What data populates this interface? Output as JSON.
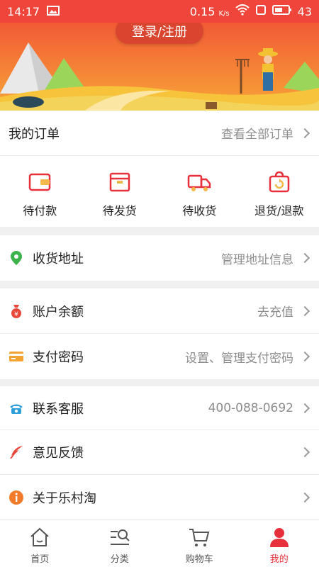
{
  "status_bar": {
    "time": "14:17",
    "net_speed": "0.15",
    "net_unit": "K/s",
    "battery": "43"
  },
  "banner": {
    "login_label": "登录/注册"
  },
  "orders": {
    "title": "我的订单",
    "view_all": "查看全部订单",
    "items": [
      {
        "label": "待付款",
        "icon": "wallet-icon"
      },
      {
        "label": "待发货",
        "icon": "box-icon"
      },
      {
        "label": "待收货",
        "icon": "truck-icon"
      },
      {
        "label": "退货/退款",
        "icon": "return-bag-icon"
      }
    ]
  },
  "address": {
    "label": "收货地址",
    "value": "管理地址信息",
    "icon": "location-pin-icon"
  },
  "account": {
    "balance": {
      "label": "账户余额",
      "value": "去充值",
      "icon": "money-bag-icon"
    },
    "password": {
      "label": "支付密码",
      "value": "设置、管理支付密码",
      "icon": "card-icon"
    }
  },
  "service": {
    "contact": {
      "label": "联系客服",
      "value": "400-088-0692",
      "icon": "phone-icon"
    },
    "feedback": {
      "label": "意见反馈",
      "icon": "feather-icon"
    },
    "about": {
      "label": "关于乐村淘",
      "icon": "info-icon"
    }
  },
  "tabbar": {
    "items": [
      {
        "label": "首页",
        "icon": "home-icon"
      },
      {
        "label": "分类",
        "icon": "category-search-icon"
      },
      {
        "label": "购物车",
        "icon": "cart-icon"
      },
      {
        "label": "我的",
        "icon": "user-icon"
      }
    ],
    "active_index": 3
  },
  "colors": {
    "accent": "#e8303c",
    "status_bar": "#f0453a",
    "login_button": "#d9452f"
  }
}
